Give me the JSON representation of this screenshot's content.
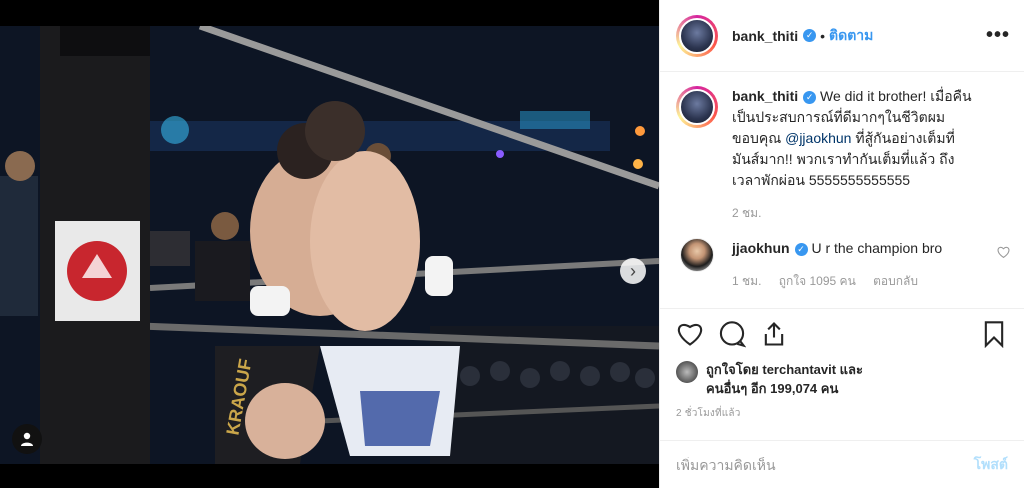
{
  "post": {
    "author": "bank_thiti",
    "follow_label": "ติดตาม",
    "more_label": "•••",
    "caption_author": "bank_thiti",
    "caption_pre": "We did it brother! เมื่อคืนเป็นประสบการณ์ที่ดีมากๆในชีวิตผม ขอบคุณ ",
    "caption_mention": "@jjaokhun",
    "caption_post": " ที่สู้กันอย่างเต็มที่ มันส์มาก!! พวกเราทำกันเต็มที่แล้ว ถึงเวลาพักผ่อน 5555555555555",
    "caption_time": "2 ชม.",
    "reply": {
      "author": "jjaokhun",
      "text": "U r the champion bro",
      "time": "1 ชม.",
      "likes": "ถูกใจ 1095 คน",
      "reply_label": "ตอบกลับ"
    },
    "liked_by_line1": "ถูกใจโดย terchantavit และ",
    "liked_by_line2": "คนอื่นๆ อีก 199,074 คน",
    "posted_ago": "2 ชั่วโมงที่แล้ว",
    "comment_placeholder": "เพิ่มความคิดเห็น",
    "post_label": "โพสต์"
  },
  "icons": {
    "verified": "verified-badge-icon",
    "heart": "heart-icon",
    "comment": "comment-icon",
    "share": "share-icon",
    "bookmark": "bookmark-icon",
    "next": "chevron-right-icon",
    "user_tag": "user-tag-icon"
  },
  "colors": {
    "accent": "#3897f0",
    "mention": "#003569",
    "muted": "#999999",
    "post_disabled": "#b2dffc"
  }
}
